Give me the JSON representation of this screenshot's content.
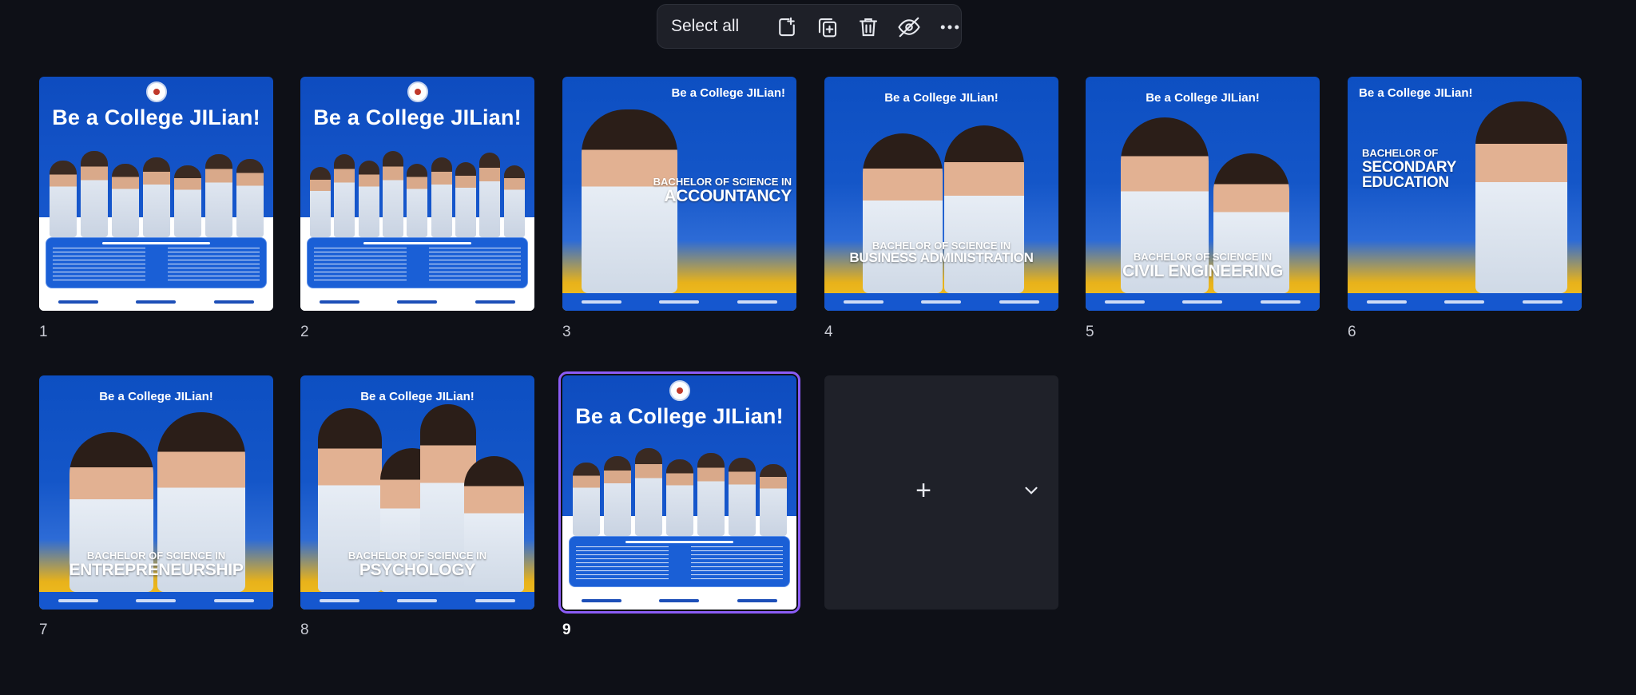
{
  "toolbar": {
    "select_all_label": "Select all",
    "buttons": [
      "add-page-icon",
      "duplicate-page-icon",
      "trash-icon",
      "hide-icon",
      "more-icon"
    ]
  },
  "pages": [
    {
      "number": "1",
      "headline": "Be a College JILian!"
    },
    {
      "number": "2",
      "headline": "Be a College JILian!"
    },
    {
      "number": "3",
      "headline": "Be a College JILian!",
      "degree_line1": "BACHELOR OF SCIENCE IN",
      "degree_line2": "ACCOUNTANCY"
    },
    {
      "number": "4",
      "headline": "Be a College JILian!",
      "degree_line1": "BACHELOR OF SCIENCE IN",
      "degree_line2": "BUSINESS ADMINISTRATION"
    },
    {
      "number": "5",
      "headline": "Be a College JILian!",
      "degree_line1": "BACHELOR OF SCIENCE IN",
      "degree_line2": "CIVIL ENGINEERING"
    },
    {
      "number": "6",
      "headline": "Be a College JILian!",
      "degree_line1": "BACHELOR OF",
      "degree_line2": "SECONDARY EDUCATION"
    },
    {
      "number": "7",
      "headline": "Be a College JILian!",
      "degree_line1": "BACHELOR OF SCIENCE IN",
      "degree_line2": "ENTREPRENEURSHIP"
    },
    {
      "number": "8",
      "headline": "Be a College JILian!",
      "degree_line1": "BACHELOR OF SCIENCE IN",
      "degree_line2": "PSYCHOLOGY"
    },
    {
      "number": "9",
      "headline": "Be a College JILian!",
      "selected": true
    }
  ],
  "programs_title": "PROGRAMS OFFERED:",
  "add_page": {
    "plus": "+"
  },
  "colors": {
    "accent": "#8b5cf6",
    "background": "#0e1017",
    "brand_blue": "#0d4fc2",
    "brand_yellow": "#f3c224"
  }
}
